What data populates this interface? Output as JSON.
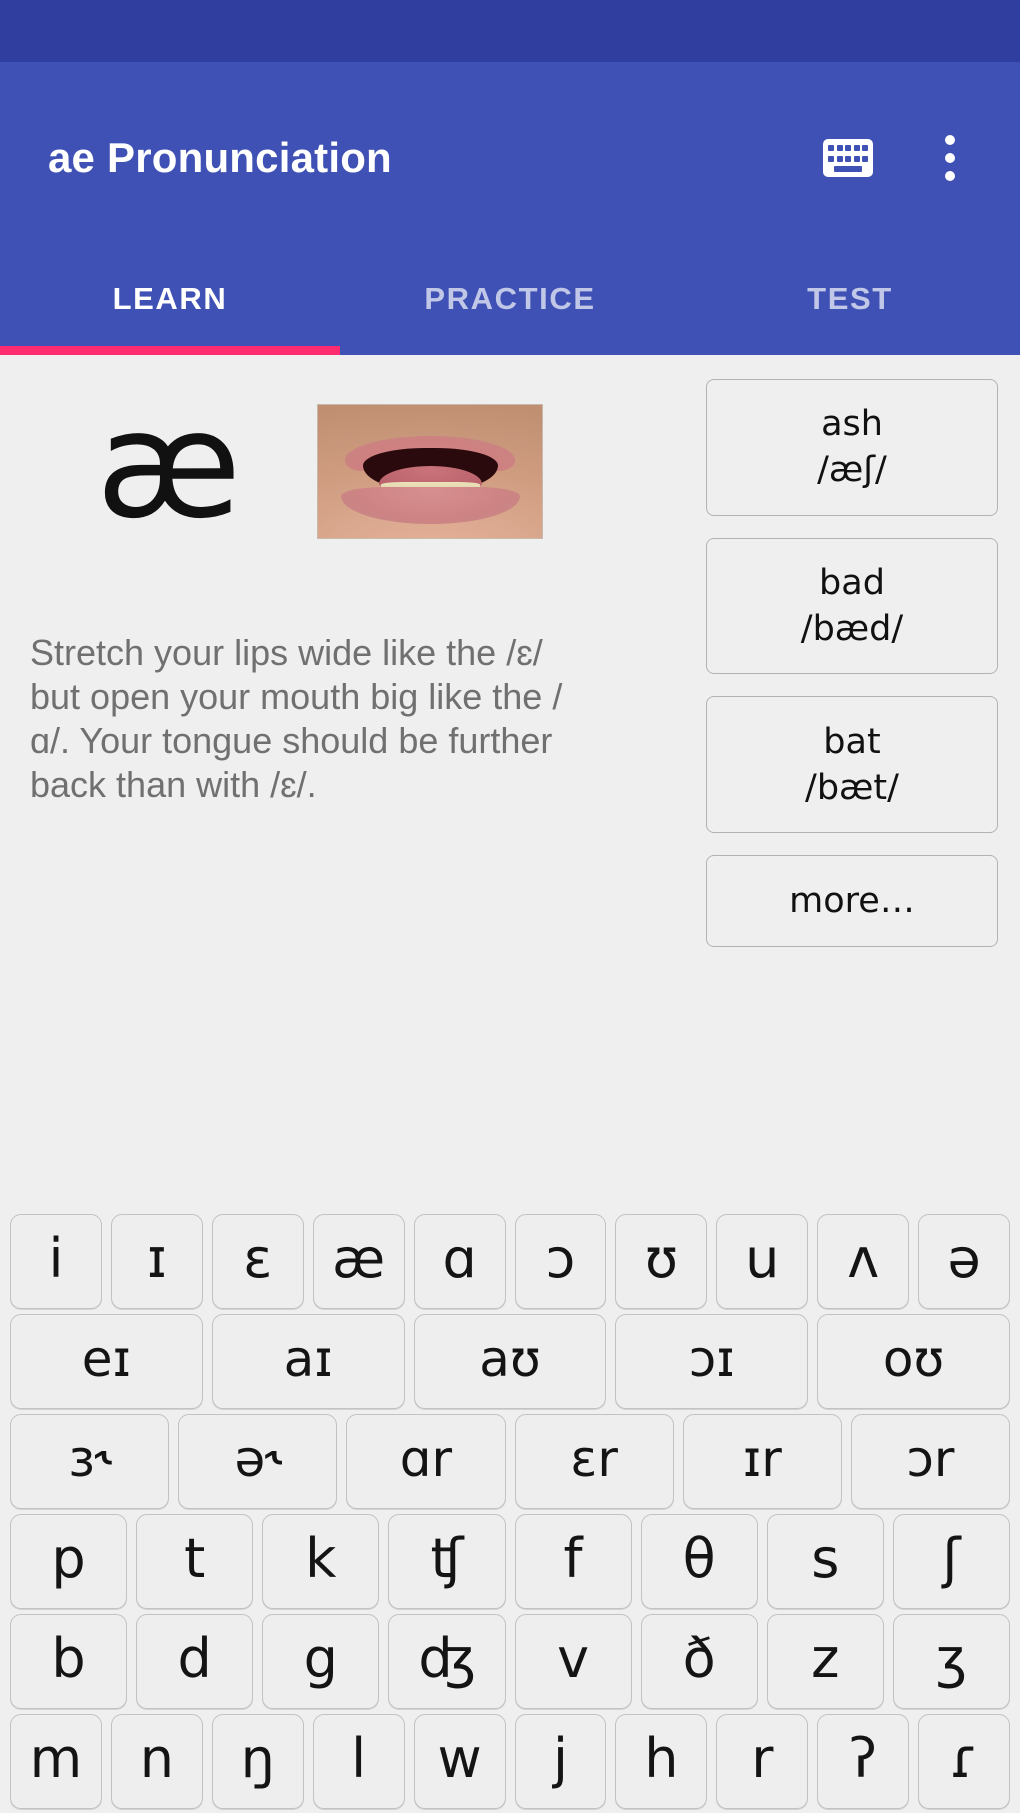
{
  "statusbar": {
    "color": "#303f9f"
  },
  "appbar": {
    "title": "ae Pronunciation",
    "color": "#3f51b5",
    "keyboard_icon": "keyboard-icon",
    "overflow_icon": "more-vert-icon"
  },
  "tabs": {
    "items": [
      {
        "label": "LEARN",
        "active": true
      },
      {
        "label": "PRACTICE",
        "active": false
      },
      {
        "label": "TEST",
        "active": false
      }
    ],
    "indicator_color": "#ff2d6f"
  },
  "learn": {
    "symbol": "æ",
    "mouth_image_alt": "mouth-articulation-photo",
    "description": "Stretch your lips wide like the /ɛ/ but open your mouth big like the /ɑ/. Your tongue should be further back than with /ɛ/.",
    "examples": [
      {
        "word": "ash",
        "ipa": "/æʃ/"
      },
      {
        "word": "bad",
        "ipa": "/bæd/"
      },
      {
        "word": "bat",
        "ipa": "/bæt/"
      }
    ],
    "more_label": "more…"
  },
  "keyboard": {
    "rows": [
      {
        "name": "monophthongs",
        "keys": [
          "i",
          "ɪ",
          "ɛ",
          "æ",
          "ɑ",
          "ɔ",
          "ʊ",
          "u",
          "ʌ",
          "ə"
        ]
      },
      {
        "name": "diphthongs",
        "keys": [
          "eɪ",
          "aɪ",
          "aʊ",
          "ɔɪ",
          "oʊ"
        ]
      },
      {
        "name": "r-colored",
        "keys": [
          "ɜ˞",
          "ə˞",
          "ɑr",
          "ɛr",
          "ɪr",
          "ɔr"
        ]
      },
      {
        "name": "voiceless-consonants",
        "keys": [
          "p",
          "t",
          "k",
          "ʧ",
          "f",
          "θ",
          "s",
          "ʃ"
        ]
      },
      {
        "name": "voiced-consonants",
        "keys": [
          "b",
          "d",
          "g",
          "ʤ",
          "v",
          "ð",
          "z",
          "ʒ"
        ]
      },
      {
        "name": "sonorants",
        "keys": [
          "m",
          "n",
          "ŋ",
          "l",
          "w",
          "j",
          "h",
          "r",
          "ʔ",
          "ɾ"
        ]
      }
    ]
  }
}
